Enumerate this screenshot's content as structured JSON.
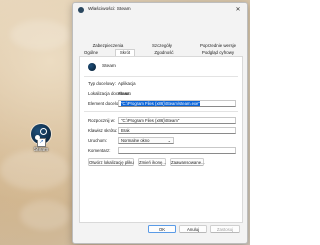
{
  "desktop": {
    "shortcut_label": "Steam",
    "icon": "steam-icon"
  },
  "dialog": {
    "title": "Właściwości: Steam",
    "close_glyph": "✕",
    "tabs_row1": [
      "Zabezpieczenia",
      "Szczegóły",
      "Poprzednie wersje"
    ],
    "tabs_row2": [
      "Ogólne",
      "Skrót",
      "Zgodność",
      "Podgląd cyfrowy"
    ],
    "active_tab": "Skrót",
    "header_name": "Steam",
    "rows": {
      "target_type_label": "Typ docelowy:",
      "target_type_value": "Aplikacja",
      "target_location_label": "Lokalizacja docelowa:",
      "target_location_value": "Steam",
      "target_label": "Element docelowy:",
      "target_value": "\"C:\\Program Files (x86)\\Steam\\steam.exe\"",
      "start_in_label": "Rozpocznij w:",
      "start_in_value": "\"C:\\Program Files (x86)\\Steam\"",
      "shortcut_key_label": "Klawisz skrótu:",
      "shortcut_key_value": "Brak",
      "run_label": "Uruchom:",
      "run_value": "Normalne okno",
      "comment_label": "Komentarz:",
      "comment_value": ""
    },
    "buttons": {
      "open_location": "Otwórz lokalizację pliku",
      "change_icon": "Zmień ikonę...",
      "advanced": "Zaawansowane...",
      "ok": "OK",
      "cancel": "Anuluj",
      "apply": "Zastosuj"
    },
    "accent_color": "#0a64d8"
  }
}
